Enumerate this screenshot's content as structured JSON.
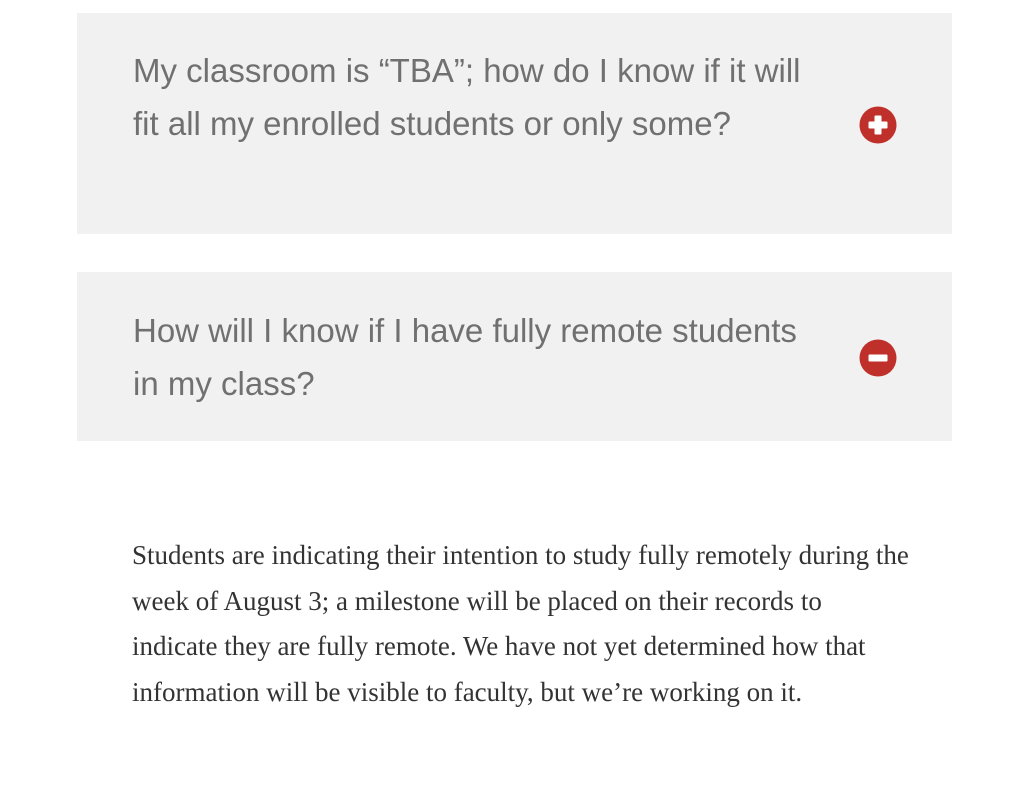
{
  "faq": {
    "items": [
      {
        "question": "My classroom is “TBA”; how do I know if it will fit all my enrolled students or only some?",
        "toggle_icon": "plus-circle-icon",
        "expanded": false
      },
      {
        "question": "How will I know if I have fully remote students in my class?",
        "toggle_icon": "minus-circle-icon",
        "expanded": true,
        "answer": "Students are indicating their intention to study fully remotely during the week of August 3; a milestone will be placed on their records to indicate they are fully remote. We have not yet determined how that information will be visible to faculty, but we’re working on it."
      }
    ]
  },
  "colors": {
    "panel_background": "#f1f1f1",
    "question_text": "#707070",
    "answer_text": "#333333",
    "icon_accent": "#c0302b"
  }
}
